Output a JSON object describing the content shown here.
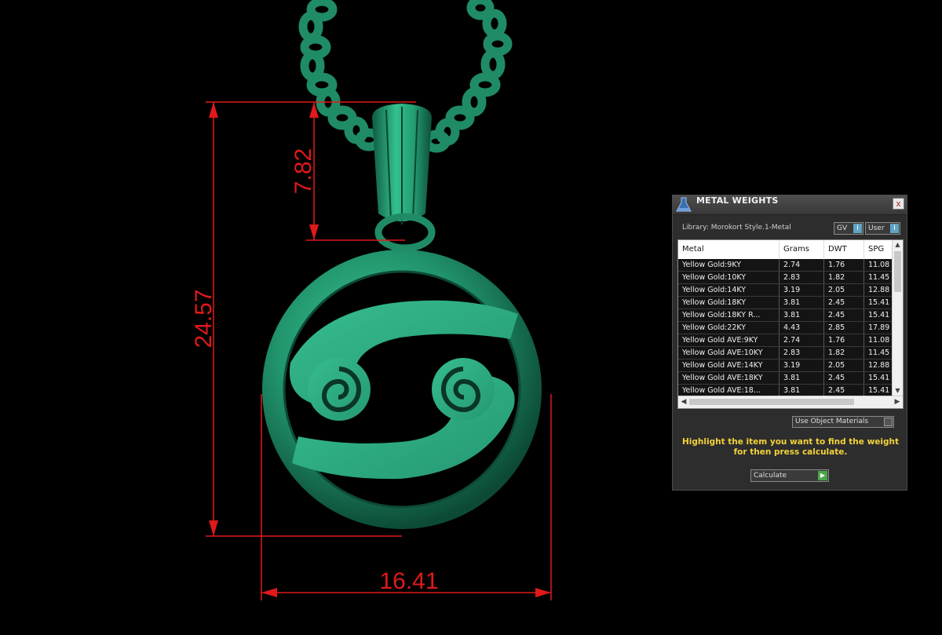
{
  "dimensions": {
    "height": "24.57",
    "bail": "7.82",
    "width": "16.41"
  },
  "panel": {
    "title": "METAL WEIGHTS",
    "close_label": "x",
    "library_label": "Library: Morokort Style.1-Metal",
    "gv_label": "GV",
    "user_label": "User",
    "toggle_indicator": "I",
    "columns": [
      "Metal",
      "Grams",
      "DWT",
      "SPG"
    ],
    "rows": [
      [
        "Yellow Gold:9KY",
        "2.74",
        "1.76",
        "11.08"
      ],
      [
        "Yellow Gold:10KY",
        "2.83",
        "1.82",
        "11.45"
      ],
      [
        "Yellow Gold:14KY",
        "3.19",
        "2.05",
        "12.88"
      ],
      [
        "Yellow Gold:18KY",
        "3.81",
        "2.45",
        "15.41"
      ],
      [
        "Yellow Gold:18KY R...",
        "3.81",
        "2.45",
        "15.41"
      ],
      [
        "Yellow Gold:22KY",
        "4.43",
        "2.85",
        "17.89"
      ],
      [
        "Yellow Gold AVE:9KY",
        "2.74",
        "1.76",
        "11.08"
      ],
      [
        "Yellow Gold AVE:10KY",
        "2.83",
        "1.82",
        "11.45"
      ],
      [
        "Yellow Gold AVE:14KY",
        "3.19",
        "2.05",
        "12.88"
      ],
      [
        "Yellow Gold AVE:18KY",
        "3.81",
        "2.45",
        "15.41"
      ],
      [
        "Yellow Gold AVE:18...",
        "3.81",
        "2.45",
        "15.41"
      ]
    ],
    "use_object_materials_label": "Use Object Materials",
    "hint_line1": "Highlight the item you want to find the weight",
    "hint_line2": "for then press calculate.",
    "calculate_label": "Calculate"
  },
  "colors": {
    "dimension": "#e0191b",
    "model": "#2aa57a",
    "hint": "#f2d23a"
  },
  "icons": {
    "title": "flask-icon",
    "play": "play-icon"
  }
}
